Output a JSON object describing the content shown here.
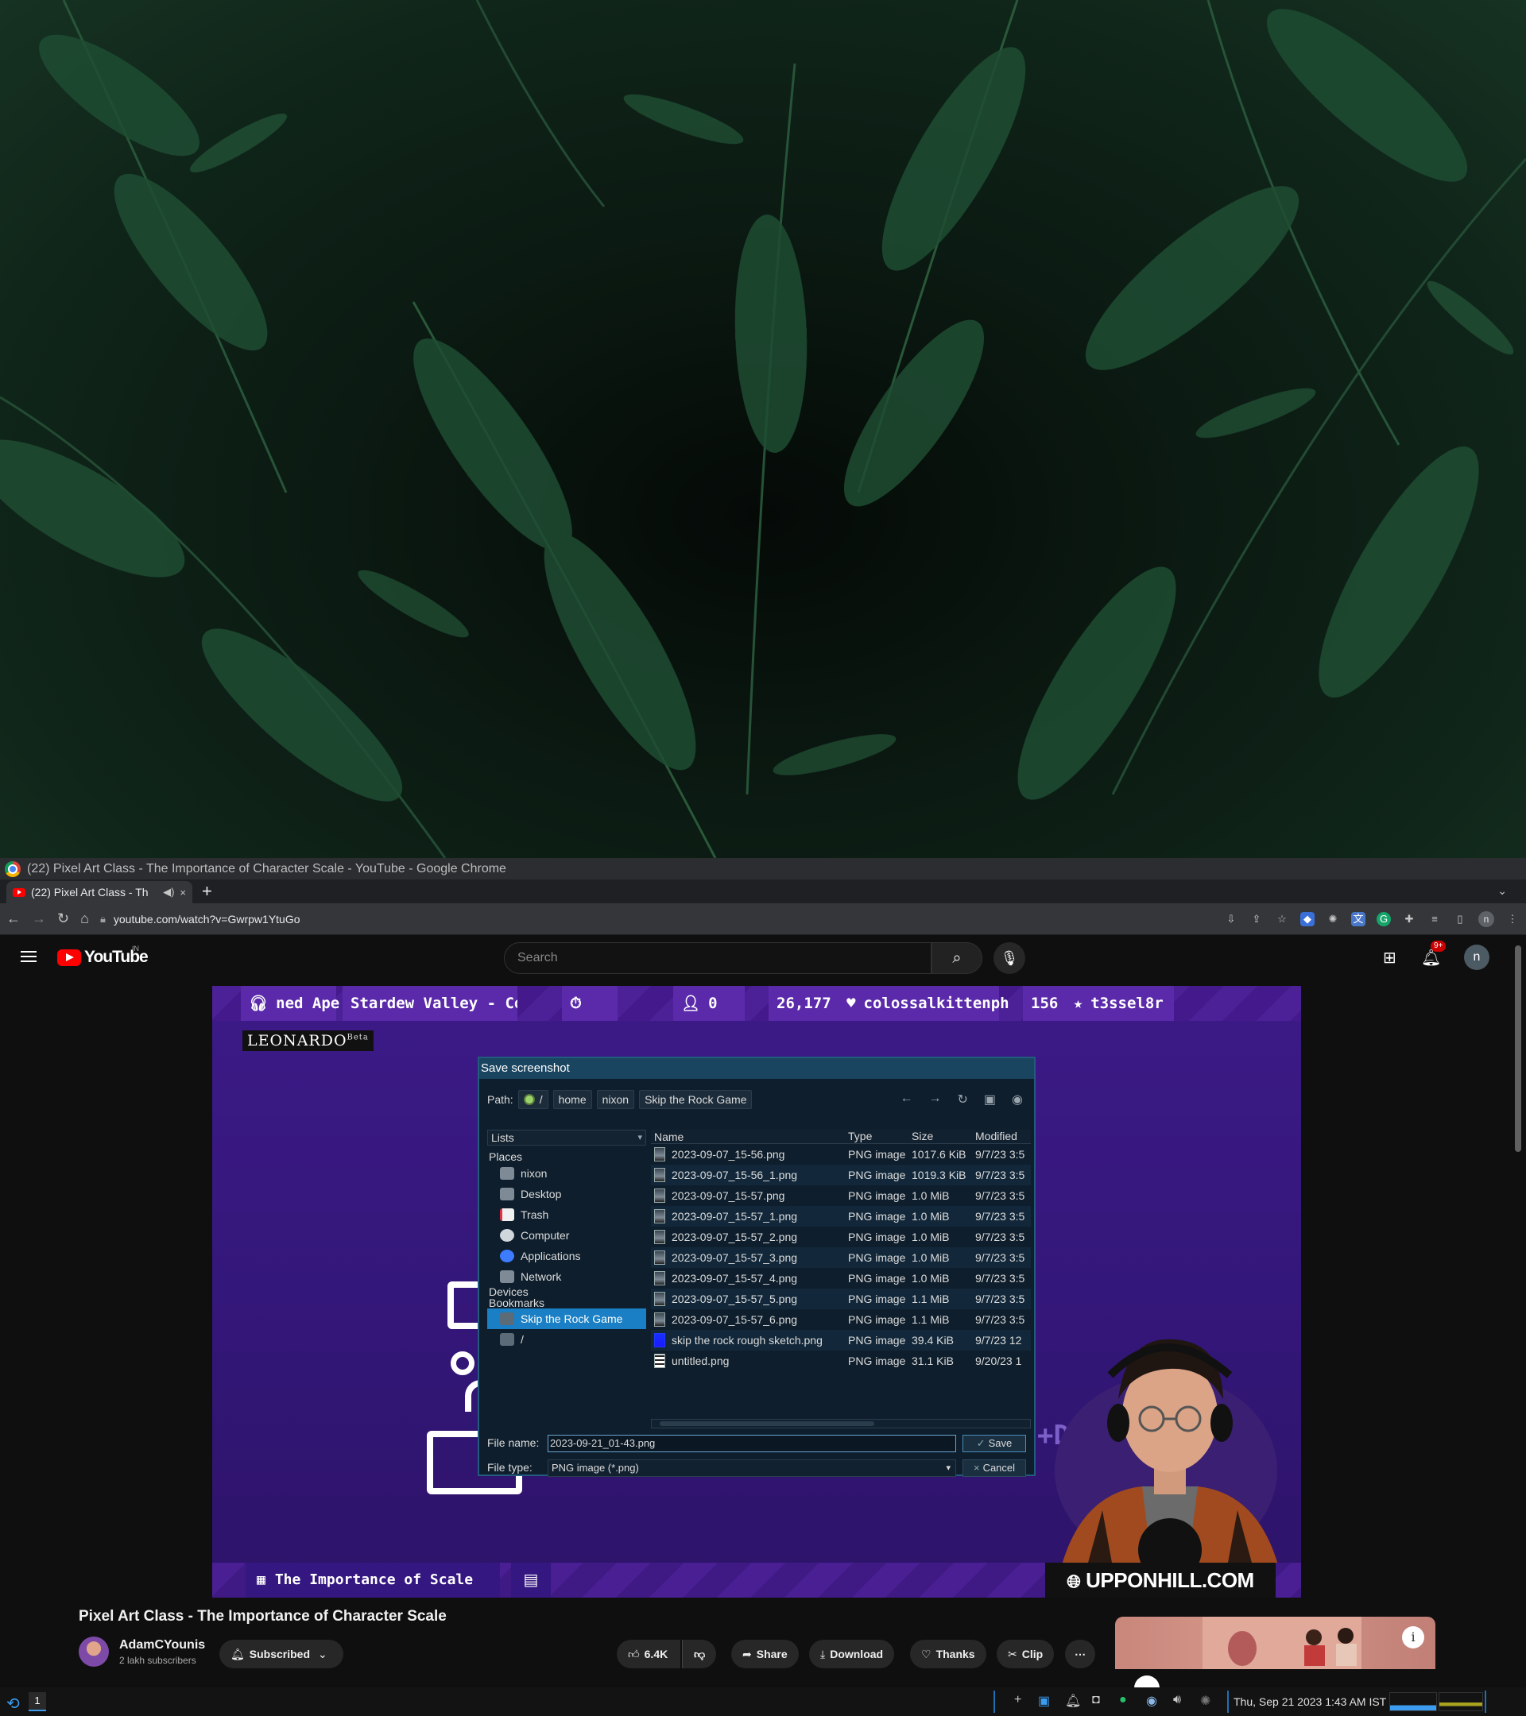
{
  "window": {
    "title": "(22) Pixel Art Class - The Importance of Character Scale - YouTube - Google Chrome"
  },
  "tab": {
    "title": "(22) Pixel Art Class - Th",
    "close": "×",
    "new_tab": "+"
  },
  "omnibox": {
    "url": "youtube.com/watch?v=Gwrpw1YtuGo"
  },
  "youtube": {
    "logo_text": "YouTube",
    "region": "IN",
    "search_placeholder": "Search",
    "notification_count": "9+",
    "avatar_letter": "n"
  },
  "stream_overlay": {
    "now_playing": "ned Ape",
    "game": "Stardew Valley - Concer",
    "viewers": "0",
    "follower_count": "26,177",
    "latest_follower": "colossalkittenph",
    "sub_count": "156",
    "latest_sub": "t3ssel8r",
    "brand": "Leonardo",
    "brand_tag": "Beta",
    "topic": "The Importance of Scale",
    "website": "UPPONHILL.COM",
    "plus_text": "+D"
  },
  "dialog": {
    "title": "Save screenshot",
    "path_label": "Path:",
    "path": [
      "/",
      "home",
      "nixon",
      "Skip the Rock Game"
    ],
    "lists_label": "Lists",
    "places_heading": "Places",
    "places": [
      {
        "label": "nixon",
        "icon": "home-folder-icon"
      },
      {
        "label": "Desktop",
        "icon": "desktop-icon"
      },
      {
        "label": "Trash",
        "icon": "trash-icon"
      },
      {
        "label": "Computer",
        "icon": "computer-icon"
      },
      {
        "label": "Applications",
        "icon": "applications-icon"
      },
      {
        "label": "Network",
        "icon": "network-icon"
      }
    ],
    "devices_heading": "Devices",
    "bookmarks_heading": "Bookmarks",
    "bookmarks": [
      {
        "label": "Skip the Rock Game",
        "selected": true
      },
      {
        "label": "/",
        "selected": false
      }
    ],
    "columns": [
      "Name",
      "Type",
      "Size",
      "Modified"
    ],
    "files": [
      {
        "name": "2023-09-07_15-56.png",
        "type": "PNG image",
        "size": "1017.6 KiB",
        "modified": "9/7/23 3:5"
      },
      {
        "name": "2023-09-07_15-56_1.png",
        "type": "PNG image",
        "size": "1019.3 KiB",
        "modified": "9/7/23 3:5"
      },
      {
        "name": "2023-09-07_15-57.png",
        "type": "PNG image",
        "size": "1.0 MiB",
        "modified": "9/7/23 3:5"
      },
      {
        "name": "2023-09-07_15-57_1.png",
        "type": "PNG image",
        "size": "1.0 MiB",
        "modified": "9/7/23 3:5"
      },
      {
        "name": "2023-09-07_15-57_2.png",
        "type": "PNG image",
        "size": "1.0 MiB",
        "modified": "9/7/23 3:5"
      },
      {
        "name": "2023-09-07_15-57_3.png",
        "type": "PNG image",
        "size": "1.0 MiB",
        "modified": "9/7/23 3:5"
      },
      {
        "name": "2023-09-07_15-57_4.png",
        "type": "PNG image",
        "size": "1.0 MiB",
        "modified": "9/7/23 3:5"
      },
      {
        "name": "2023-09-07_15-57_5.png",
        "type": "PNG image",
        "size": "1.1 MiB",
        "modified": "9/7/23 3:5"
      },
      {
        "name": "2023-09-07_15-57_6.png",
        "type": "PNG image",
        "size": "1.1 MiB",
        "modified": "9/7/23 3:5"
      },
      {
        "name": "skip the rock rough sketch.png",
        "type": "PNG image",
        "size": "39.4 KiB",
        "modified": "9/7/23 12"
      },
      {
        "name": "untitled.png",
        "type": "PNG image",
        "size": "31.1 KiB",
        "modified": "9/20/23 1"
      }
    ],
    "file_name_label": "File name:",
    "file_name": "2023-09-21_01-43.png",
    "file_type_label": "File type:",
    "file_type": "PNG image (*.png)",
    "save_label": "Save",
    "cancel_label": "Cancel"
  },
  "video": {
    "title": "Pixel Art Class - The Importance of Character Scale",
    "channel": "AdamCYounis",
    "subscribers": "2 lakh subscribers",
    "subscribed_label": "Subscribed",
    "likes": "6.4K",
    "share_label": "Share",
    "download_label": "Download",
    "thanks_label": "Thanks",
    "clip_label": "Clip",
    "more_label": "⋯"
  },
  "taskbar": {
    "workspace": "1",
    "clock": "Thu, Sep 21 2023 1:43 AM IST"
  },
  "colors": {
    "youtube_red": "#ff0000",
    "dialog_selection": "#1a7fc4",
    "stream_purple": "#3c1a87"
  }
}
